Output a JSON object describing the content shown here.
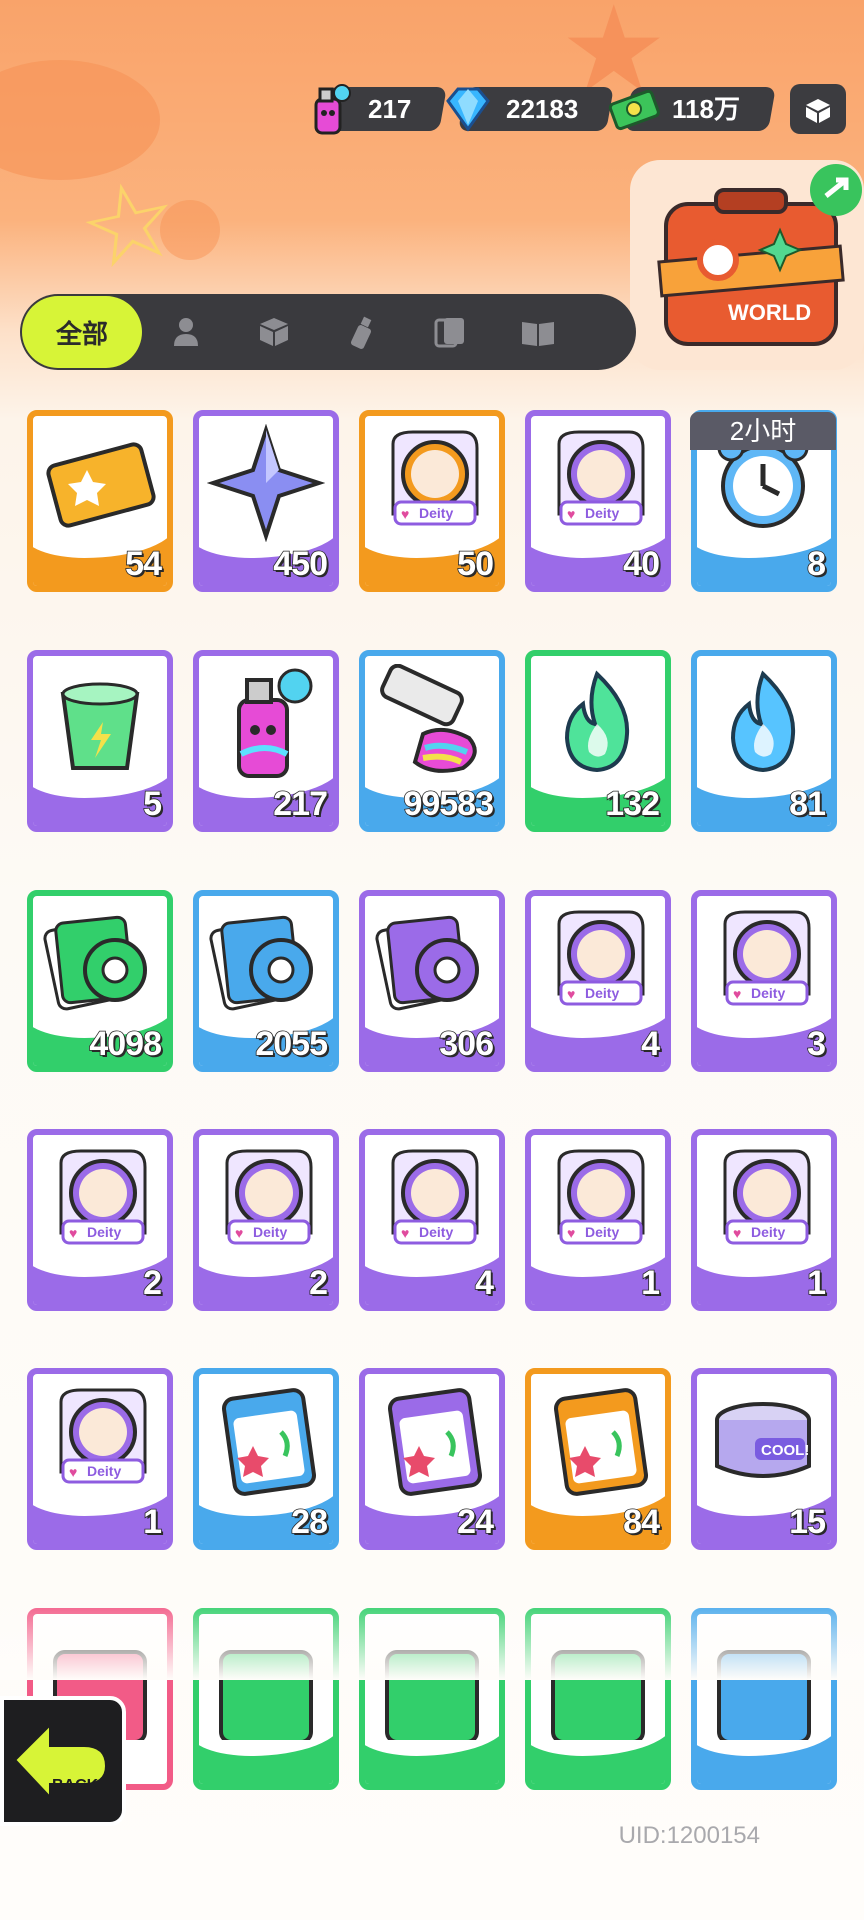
{
  "resources": [
    {
      "name": "spray-can",
      "amount": "217"
    },
    {
      "name": "diamond",
      "amount": "22183"
    },
    {
      "name": "cash",
      "amount": "118万"
    }
  ],
  "tabs": [
    {
      "label": "全部",
      "icon": "all",
      "active": true
    },
    {
      "label": "",
      "icon": "person-icon"
    },
    {
      "label": "",
      "icon": "box-icon"
    },
    {
      "label": "",
      "icon": "spray-icon"
    },
    {
      "label": "",
      "icon": "cards-icon"
    },
    {
      "label": "",
      "icon": "book-icon"
    }
  ],
  "event_banner": {
    "label": "WORLD"
  },
  "timer_label": "2小时",
  "items": [
    {
      "name": "ticket",
      "rarity": "orange",
      "qty": "54"
    },
    {
      "name": "blue-star",
      "rarity": "purple",
      "qty": "450"
    },
    {
      "name": "deity-mystery-gold",
      "rarity": "orange",
      "qty": "50"
    },
    {
      "name": "deity-mystery-purple",
      "rarity": "purple",
      "qty": "40"
    },
    {
      "name": "alarm-clock",
      "rarity": "blue",
      "qty": "8"
    },
    {
      "name": "energy-drink",
      "rarity": "purple",
      "qty": "5"
    },
    {
      "name": "spray-can",
      "rarity": "purple",
      "qty": "217"
    },
    {
      "name": "paint-tube",
      "rarity": "blue",
      "qty": "99583"
    },
    {
      "name": "green-flame",
      "rarity": "green",
      "qty": "132"
    },
    {
      "name": "blue-flame",
      "rarity": "blue",
      "qty": "81"
    },
    {
      "name": "green-tape",
      "rarity": "green",
      "qty": "4098"
    },
    {
      "name": "blue-tape",
      "rarity": "blue",
      "qty": "2055"
    },
    {
      "name": "purple-tape",
      "rarity": "purple",
      "qty": "306"
    },
    {
      "name": "deity-portrait-1",
      "rarity": "purple",
      "qty": "4"
    },
    {
      "name": "deity-portrait-2",
      "rarity": "purple",
      "qty": "3"
    },
    {
      "name": "deity-portrait-3",
      "rarity": "purple",
      "qty": "2"
    },
    {
      "name": "deity-portrait-4",
      "rarity": "purple",
      "qty": "2"
    },
    {
      "name": "deity-portrait-5",
      "rarity": "purple",
      "qty": "4"
    },
    {
      "name": "deity-portrait-6",
      "rarity": "purple",
      "qty": "1"
    },
    {
      "name": "deity-portrait-7",
      "rarity": "purple",
      "qty": "1"
    },
    {
      "name": "deity-portrait-8",
      "rarity": "purple",
      "qty": "1"
    },
    {
      "name": "sticker-pack-blue",
      "rarity": "blue",
      "qty": "28"
    },
    {
      "name": "sticker-pack-purple",
      "rarity": "purple",
      "qty": "24"
    },
    {
      "name": "sticker-pack-orange",
      "rarity": "orange",
      "qty": "84"
    },
    {
      "name": "cool-can",
      "rarity": "purple",
      "qty": "15"
    },
    {
      "name": "card-pink",
      "rarity": "pink",
      "qty": ""
    },
    {
      "name": "card-green-1",
      "rarity": "green",
      "qty": ""
    },
    {
      "name": "card-green-2",
      "rarity": "green",
      "qty": ""
    },
    {
      "name": "card-green-3",
      "rarity": "green",
      "qty": ""
    },
    {
      "name": "card-blue",
      "rarity": "blue",
      "qty": ""
    }
  ],
  "deity_label": "Deity",
  "back_label": "BACK",
  "uid": "UID:1200154",
  "colors": {
    "orange": "#f39a1e",
    "purple": "#9b6be8",
    "blue": "#49a9ec",
    "green": "#32cf6b",
    "pink": "#f25b87",
    "accent": "#d7f437"
  }
}
